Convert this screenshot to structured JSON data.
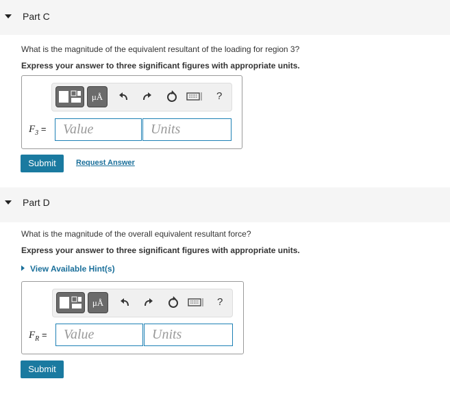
{
  "partC": {
    "title": "Part C",
    "question": "What is the magnitude of the equivalent resultant of the loading for region 3?",
    "instruction": "Express your answer to three significant figures with appropriate units.",
    "var_main": "F",
    "var_sub": "3",
    "equals": "=",
    "value_placeholder": "Value",
    "units_placeholder": "Units",
    "mu_label": "μÅ",
    "help_label": "?",
    "submit_label": "Submit",
    "request_label": "Request Answer"
  },
  "partD": {
    "title": "Part D",
    "question": "What is the magnitude of the overall equivalent resultant force?",
    "instruction": "Express your answer to three significant figures with appropriate units.",
    "hint_label": "View Available Hint(s)",
    "var_main": "F",
    "var_sub": "R",
    "equals": "=",
    "value_placeholder": "Value",
    "units_placeholder": "Units",
    "mu_label": "μÅ",
    "help_label": "?",
    "submit_label": "Submit"
  },
  "icons": [
    "templates-icon",
    "undo-icon",
    "redo-icon",
    "reset-icon",
    "keyboard-icon",
    "help-icon"
  ],
  "colors": {
    "accent": "#1a7aa0",
    "link": "#1a6f9a",
    "field_border": "#1b7fb4"
  }
}
